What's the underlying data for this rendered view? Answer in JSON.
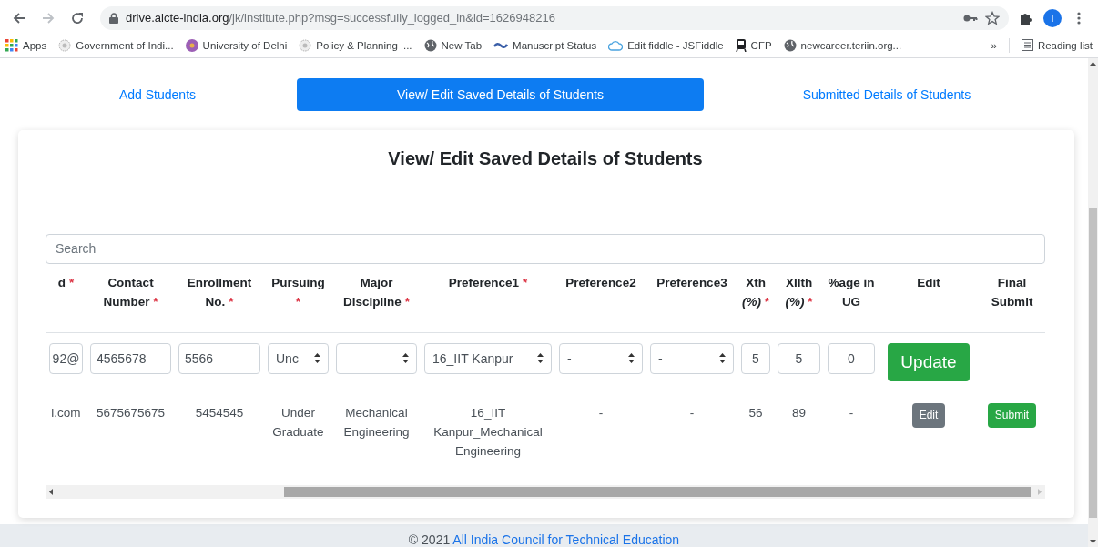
{
  "browser": {
    "url_host": "drive.aicte-india.org",
    "url_path": "/jk/institute.php?msg=successfully_logged_in&id=1626948216",
    "profile_initial": "I",
    "bookmarks": [
      {
        "label": "Apps",
        "kind": "apps"
      },
      {
        "label": "Government of Indi...",
        "kind": "seal"
      },
      {
        "label": "University of Delhi",
        "kind": "badge"
      },
      {
        "label": "Policy & Planning |...",
        "kind": "seal"
      },
      {
        "label": "New Tab",
        "kind": "globe"
      },
      {
        "label": "Manuscript Status",
        "kind": "wave"
      },
      {
        "label": "Edit fiddle - JSFiddle",
        "kind": "cloud"
      },
      {
        "label": "CFP",
        "kind": "train"
      },
      {
        "label": "newcareer.teriin.org...",
        "kind": "globe"
      }
    ],
    "overflow": "»",
    "reading_list": "Reading list"
  },
  "tabs": [
    {
      "label": "Add Students",
      "selected": false
    },
    {
      "label": "View/ Edit Saved Details of Students",
      "selected": true
    },
    {
      "label": "Submitted Details of Students",
      "selected": false
    }
  ],
  "card": {
    "title": "View/ Edit Saved Details of Students",
    "search": {
      "placeholder": "Search"
    },
    "table": {
      "columns": [
        {
          "label": "d",
          "mark": "*"
        },
        {
          "label": "Contact Number",
          "mark": "*"
        },
        {
          "label": "Enrollment No.",
          "mark": "*"
        },
        {
          "label": "Pursuing",
          "mark": "*"
        },
        {
          "label": "Major Discipline",
          "mark": "*"
        },
        {
          "label": "Preference1",
          "mark": "*"
        },
        {
          "label": "Preference2"
        },
        {
          "label": "Preference3"
        },
        {
          "label": "Xth *(%)*",
          "mark": "*"
        },
        {
          "label": "XIIth *(%)*",
          "mark": "*"
        },
        {
          "label": "%age in UG"
        },
        {
          "label": "Edit"
        },
        {
          "label": "Final Submit"
        }
      ],
      "rows": [
        {
          "cells": [
            {
              "kind": "input",
              "value": "92@"
            },
            {
              "kind": "input",
              "value": "4565678"
            },
            {
              "kind": "input",
              "value": "5566"
            },
            {
              "kind": "select",
              "value": "Unc"
            },
            {
              "kind": "select"
            },
            {
              "kind": "select",
              "value": "16_IIT Kanpur"
            },
            {
              "kind": "select",
              "value": "-"
            },
            {
              "kind": "select",
              "value": "-"
            },
            {
              "kind": "input",
              "value": "5"
            },
            {
              "kind": "input",
              "value": "5"
            },
            {
              "kind": "input",
              "value": "0"
            },
            {
              "kind": "largebutton",
              "label": "Update"
            },
            {
              "kind": "empty"
            }
          ]
        },
        {
          "cells": [
            {
              "kind": "text",
              "text": "l.com"
            },
            {
              "kind": "text",
              "text": "5675675675"
            },
            {
              "kind": "text",
              "text": "5454545"
            },
            {
              "kind": "text",
              "text": "Under Graduate"
            },
            {
              "kind": "text",
              "text": "Mechanical Engineering"
            },
            {
              "kind": "text",
              "text": "16_IIT Kanpur_Mechanical Engineering"
            },
            {
              "kind": "text",
              "text": "-"
            },
            {
              "kind": "text",
              "text": "-"
            },
            {
              "kind": "text",
              "text": "56"
            },
            {
              "kind": "text",
              "text": "89"
            },
            {
              "kind": "text",
              "text": "-"
            },
            {
              "kind": "mutedbutton",
              "label": "Edit"
            },
            {
              "kind": "greenbutton",
              "label": "Submit"
            }
          ]
        }
      ]
    }
  },
  "footer": {
    "text": "© 2021",
    "link": "All India Council for Technical Education"
  }
}
